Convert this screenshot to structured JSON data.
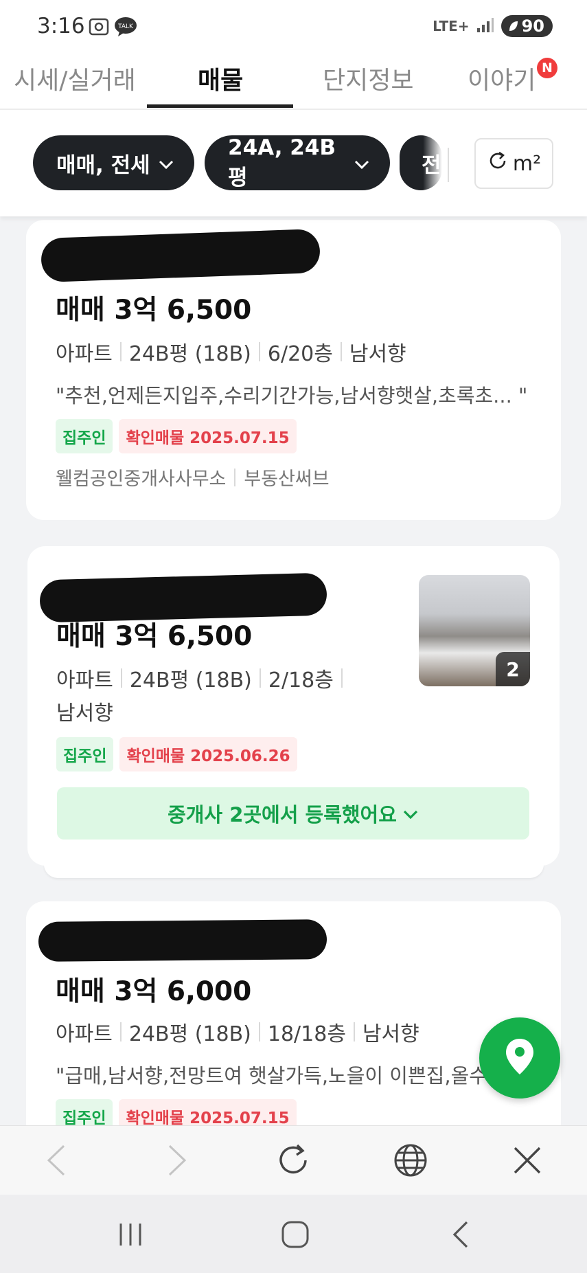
{
  "status_bar": {
    "time": "3:16",
    "talk_label": "TALK",
    "network": "LTE+",
    "battery": "90"
  },
  "tabs": [
    {
      "label": "시세/실거래",
      "active": false
    },
    {
      "label": "매물",
      "active": true
    },
    {
      "label": "단지정보",
      "active": false
    },
    {
      "label": "이야기",
      "active": false
    }
  ],
  "tab_badge": "N",
  "filters": {
    "trade_type": "매매, 전세",
    "area": "24A, 24B평",
    "partial_chip": "전",
    "unit_label": "m²"
  },
  "listings": [
    {
      "price": "매매 3억 6,500",
      "specs": [
        "아파트",
        "24B평 (18B)",
        "6/20층",
        "남서향"
      ],
      "description": "\"추천,언제든지입주,수리기간가능,남서향햇살,초록초...  \"",
      "badges": {
        "owner": "집주인",
        "verified": "확인매물 2025.07.15"
      },
      "agents": [
        "웰컴공인중개사사무소",
        "부동산써브"
      ]
    },
    {
      "price": "매매 3억 6,500",
      "specs_line1": [
        "아파트",
        "24B평 (18B)",
        "2/18층"
      ],
      "specs_line2": "남서향",
      "photo_count": "2",
      "badges": {
        "owner": "집주인",
        "verified": "확인매물 2025.06.26"
      },
      "agents_button": "중개사 2곳에서 등록했어요"
    },
    {
      "price": "매매 3억 6,000",
      "specs": [
        "아파트",
        "24B평 (18B)",
        "18/18층",
        "남서향"
      ],
      "description": "\"급매,남서향,전망트여 햇살가득,노을이 이쁜집,올수",
      "badges": {
        "owner": "집주인",
        "verified": "확인매물 2025.07.15"
      }
    }
  ],
  "colors": {
    "accent_green": "#15b04b",
    "chip_dark": "#1f2226",
    "verify_red": "#e3414b"
  },
  "icons": [
    "map-pin-icon",
    "refresh-icon",
    "chevron-down-icon",
    "back-icon",
    "forward-icon",
    "globe-icon",
    "close-icon",
    "recents-icon",
    "home-icon",
    "system-back-icon"
  ]
}
